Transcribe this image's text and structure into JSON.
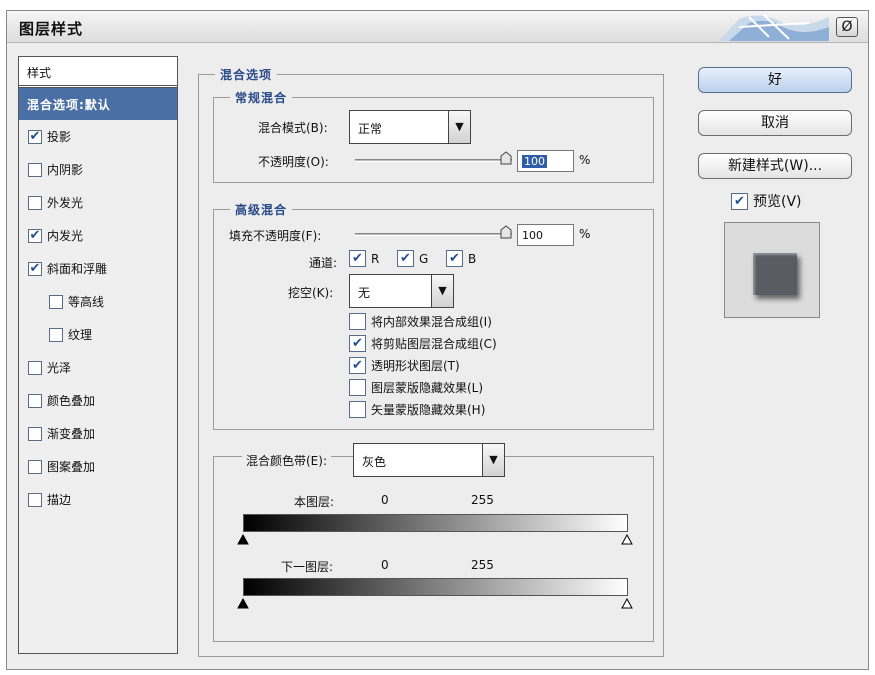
{
  "title": "图层样式",
  "close_icon_glyph": "Ø",
  "style_list": {
    "header": "样式",
    "selected": "混合选项:默认",
    "items": [
      {
        "label": "投影",
        "checked": true,
        "indent": false
      },
      {
        "label": "内阴影",
        "checked": false,
        "indent": false
      },
      {
        "label": "外发光",
        "checked": false,
        "indent": false
      },
      {
        "label": "内发光",
        "checked": true,
        "indent": false
      },
      {
        "label": "斜面和浮雕",
        "checked": true,
        "indent": false
      },
      {
        "label": "等高线",
        "checked": false,
        "indent": true
      },
      {
        "label": "纹理",
        "checked": false,
        "indent": true
      },
      {
        "label": "光泽",
        "checked": false,
        "indent": false
      },
      {
        "label": "颜色叠加",
        "checked": false,
        "indent": false
      },
      {
        "label": "渐变叠加",
        "checked": false,
        "indent": false
      },
      {
        "label": "图案叠加",
        "checked": false,
        "indent": false
      },
      {
        "label": "描边",
        "checked": false,
        "indent": false
      }
    ]
  },
  "blend_options": {
    "legend": "混合选项",
    "general": {
      "legend": "常规混合",
      "blend_mode_label": "混合模式(B):",
      "blend_mode_value": "正常",
      "opacity_label": "不透明度(O):",
      "opacity_value": "100",
      "opacity_level": 1.0,
      "percent": "%"
    },
    "advanced": {
      "legend": "高级混合",
      "fill_opacity_label": "填充不透明度(F):",
      "fill_opacity_value": "100",
      "fill_opacity_level": 1.0,
      "percent": "%",
      "channels_label": "通道:",
      "channels": [
        {
          "label": "R",
          "checked": true
        },
        {
          "label": "G",
          "checked": true
        },
        {
          "label": "B",
          "checked": true
        }
      ],
      "knockout_label": "挖空(K):",
      "knockout_value": "无",
      "options": [
        {
          "label": "将内部效果混合成组(I)",
          "checked": false
        },
        {
          "label": "将剪贴图层混合成组(C)",
          "checked": true
        },
        {
          "label": "透明形状图层(T)",
          "checked": true
        },
        {
          "label": "图层蒙版隐藏效果(L)",
          "checked": false
        },
        {
          "label": "矢量蒙版隐藏效果(H)",
          "checked": false
        }
      ]
    },
    "blend_if": {
      "label": "混合颜色带(E):",
      "value": "灰色",
      "this_layer_label": "本图层:",
      "underlying_label": "下一图层:",
      "min": "0",
      "max": "255"
    }
  },
  "buttons": {
    "ok": "好",
    "cancel": "取消",
    "new_style": "新建样式(W)..."
  },
  "preview": {
    "label": "预览(V)",
    "checked": true
  }
}
